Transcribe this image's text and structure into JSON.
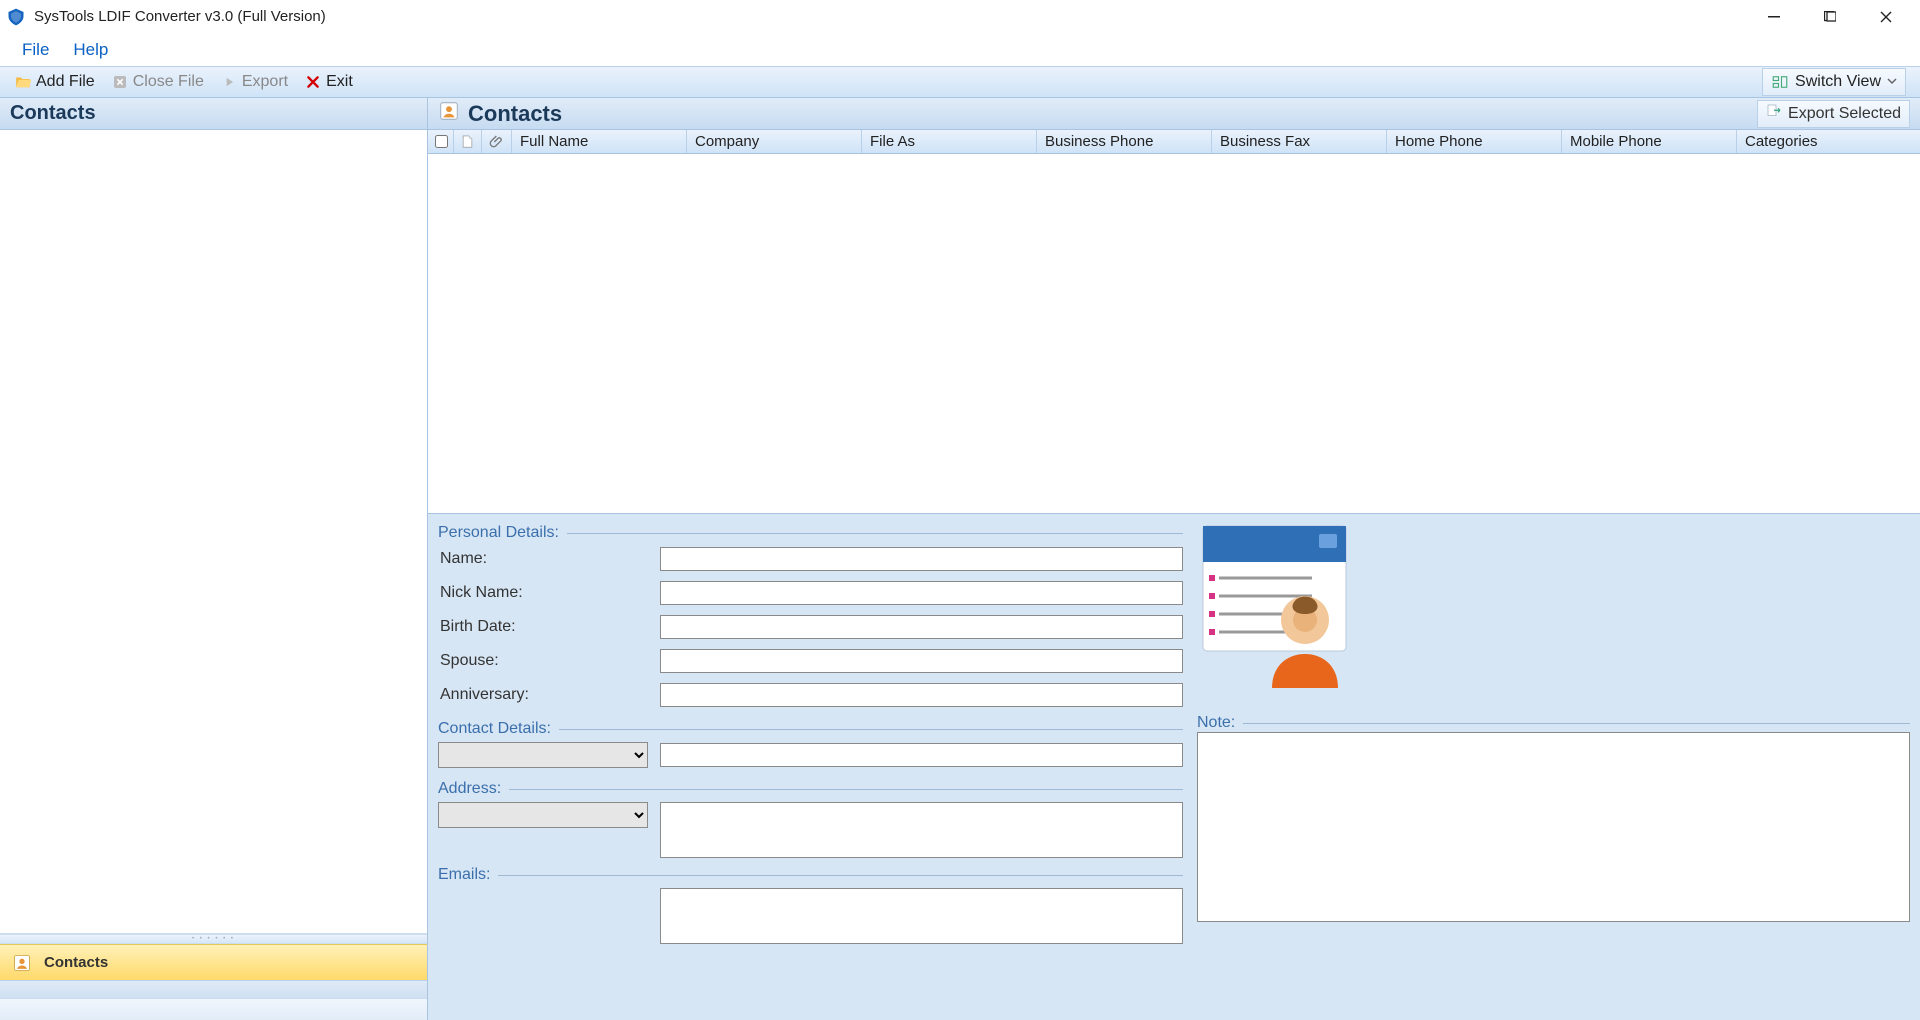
{
  "window": {
    "title": "SysTools LDIF Converter v3.0 (Full Version)"
  },
  "menu": {
    "file": "File",
    "help": "Help"
  },
  "toolbar": {
    "add_file": "Add File",
    "close_file": "Close File",
    "export": "Export",
    "exit": "Exit",
    "switch_view": "Switch View"
  },
  "left_pane": {
    "title": "Contacts",
    "category": "Contacts"
  },
  "contacts_pane": {
    "title": "Contacts",
    "export_selected": "Export Selected",
    "columns": {
      "full_name": "Full Name",
      "company": "Company",
      "file_as": "File As",
      "business_phone": "Business Phone",
      "business_fax": "Business Fax",
      "home_phone": "Home Phone",
      "mobile_phone": "Mobile Phone",
      "categories": "Categories"
    }
  },
  "details": {
    "personal": {
      "group": "Personal Details:",
      "name": "Name:",
      "nick": "Nick Name:",
      "birth": "Birth Date:",
      "spouse": "Spouse:",
      "anniversary": "Anniversary:"
    },
    "contact": {
      "group": "Contact Details:"
    },
    "address": {
      "group": "Address:"
    },
    "emails": {
      "group": "Emails:"
    },
    "note": {
      "group": "Note:"
    }
  }
}
